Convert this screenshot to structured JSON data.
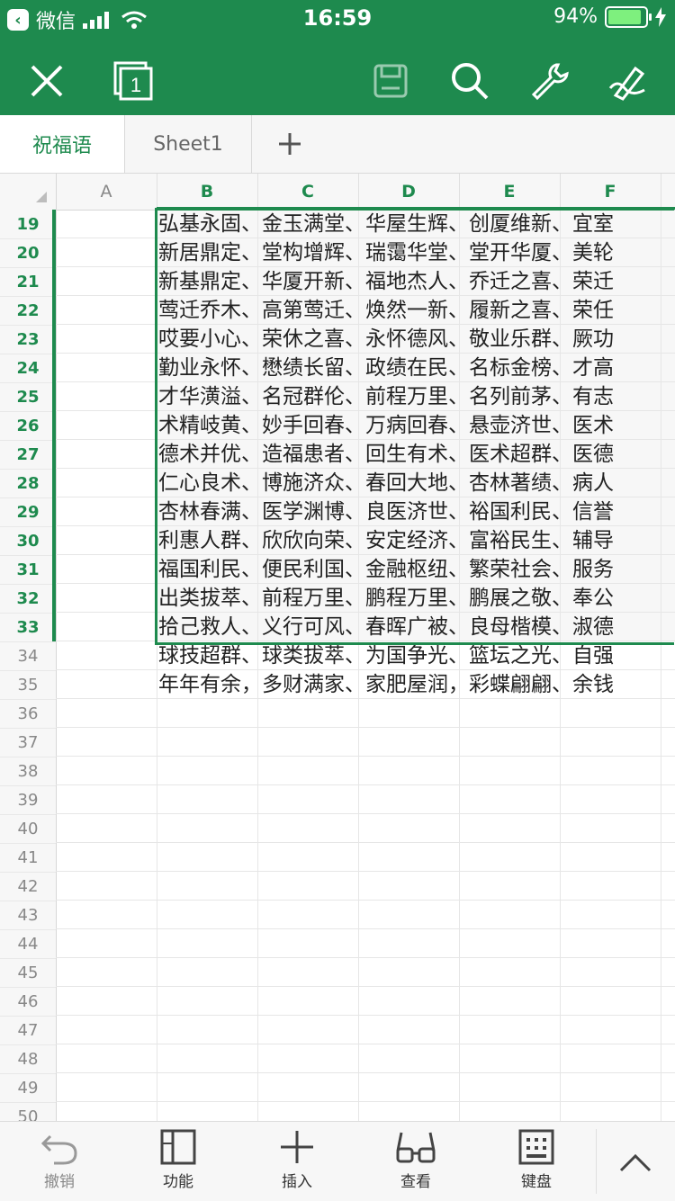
{
  "status_bar": {
    "back_label": "微信",
    "time": "16:59",
    "battery_percent": "94%",
    "battery_level": 0.94
  },
  "toolbar": {
    "icons": [
      "close-icon",
      "window-count-icon",
      "save-icon",
      "search-icon",
      "wrench-icon",
      "pen-icon"
    ],
    "window_count": "1"
  },
  "tabs": [
    {
      "label": "祝福语",
      "active": true
    },
    {
      "label": "Sheet1",
      "active": false
    }
  ],
  "columns": [
    "A",
    "B",
    "C",
    "D",
    "E",
    "F"
  ],
  "rows": [
    {
      "num": "19",
      "text": "弘基永固、金玉满堂、华屋生辉、创厦维新、宜室"
    },
    {
      "num": "20",
      "text": "新居鼎定、堂构增辉、瑞霭华堂、堂开华厦、美轮"
    },
    {
      "num": "21",
      "text": "新基鼎定、华厦开新、福地杰人、乔迁之喜、荣迁"
    },
    {
      "num": "22",
      "text": "莺迁乔木、高第莺迁、焕然一新、履新之喜、荣任"
    },
    {
      "num": "23",
      "text": "哎要小心、荣休之喜、永怀德风、敬业乐群、厥功"
    },
    {
      "num": "24",
      "text": "勤业永怀、懋绩长留、政绩在民、名标金榜、才高"
    },
    {
      "num": "25",
      "text": "才华潢溢、名冠群伦、前程万里、名列前茅、有志"
    },
    {
      "num": "26",
      "text": "术精岐黄、妙手回春、万病回春、悬壶济世、医术"
    },
    {
      "num": "27",
      "text": "德术并优、造福患者、回生有术、医术超群、医德"
    },
    {
      "num": "28",
      "text": "仁心良术、博施济众、春回大地、杏林著绩、病人"
    },
    {
      "num": "29",
      "text": "杏林春满、医学渊博、良医济世、裕国利民、信誉"
    },
    {
      "num": "30",
      "text": "利惠人群、欣欣向荣、安定经济、富裕民生、辅导"
    },
    {
      "num": "31",
      "text": "福国利民、便民利国、金融枢纽、繁荣社会、服务"
    },
    {
      "num": "32",
      "text": "出类拔萃、前程万里、鹏程万里、鹏展之敬、奉公"
    },
    {
      "num": "33",
      "text": "拾己救人、义行可风、春晖广被、良母楷模、淑德"
    },
    {
      "num": "34",
      "text": "球技超群、球类拔萃、为国争光、篮坛之光、自强"
    },
    {
      "num": "35",
      "text": "年年有余，多财满家、家肥屋润，彩蝶翩翩、余钱"
    },
    {
      "num": "36",
      "text": ""
    },
    {
      "num": "37",
      "text": ""
    },
    {
      "num": "38",
      "text": ""
    },
    {
      "num": "39",
      "text": ""
    },
    {
      "num": "40",
      "text": ""
    },
    {
      "num": "41",
      "text": ""
    },
    {
      "num": "42",
      "text": ""
    },
    {
      "num": "43",
      "text": ""
    },
    {
      "num": "44",
      "text": ""
    },
    {
      "num": "45",
      "text": ""
    },
    {
      "num": "46",
      "text": ""
    },
    {
      "num": "47",
      "text": ""
    },
    {
      "num": "48",
      "text": ""
    },
    {
      "num": "49",
      "text": ""
    },
    {
      "num": "50",
      "text": ""
    }
  ],
  "bottom_bar": [
    {
      "label": "撤销",
      "icon": "undo-icon"
    },
    {
      "label": "功能",
      "icon": "panel-icon"
    },
    {
      "label": "插入",
      "icon": "plus-icon"
    },
    {
      "label": "查看",
      "icon": "glasses-icon"
    },
    {
      "label": "键盘",
      "icon": "keyboard-icon"
    },
    {
      "label": "",
      "icon": "chevron-up-icon"
    }
  ],
  "colors": {
    "accent": "#1e8a4e",
    "battery": "#7ef07e"
  }
}
